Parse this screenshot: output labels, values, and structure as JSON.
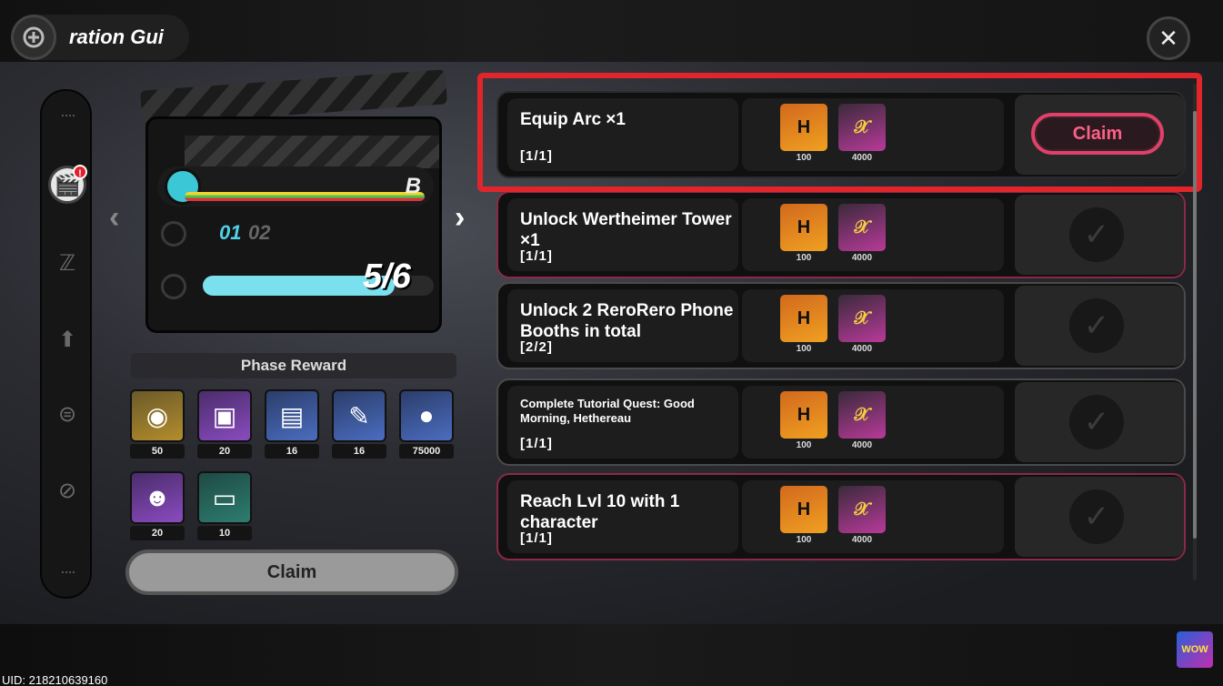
{
  "header": {
    "title": "ration Gui",
    "close_label": "✕"
  },
  "sidenav": {
    "badge": "!",
    "items": [
      {
        "icon": "clapperboard-icon"
      },
      {
        "icon": "z-logo-icon"
      },
      {
        "icon": "arrow-up-icon"
      },
      {
        "icon": "hamburger-icon"
      },
      {
        "icon": "no-eye-icon"
      }
    ]
  },
  "phase": {
    "rank": "B",
    "current": "01",
    "next": "02",
    "progress_text": "5/6",
    "progress_fraction": 0.83,
    "reward_title": "Phase Reward",
    "claim_label": "Claim"
  },
  "phase_rewards": [
    {
      "qty": "50",
      "icon": "polychrome-orb-icon",
      "color": "gold"
    },
    {
      "qty": "20",
      "icon": "tape-chip-icon",
      "color": "purple"
    },
    {
      "qty": "16",
      "icon": "data-card-icon",
      "color": "blue"
    },
    {
      "qty": "16",
      "icon": "paint-tube-icon",
      "color": "blue"
    },
    {
      "qty": "75000",
      "icon": "coin-icon",
      "color": "blue"
    },
    {
      "qty": "20",
      "icon": "bangboo-icon",
      "color": "purple"
    },
    {
      "qty": "10",
      "icon": "supply-case-icon",
      "color": "teal"
    }
  ],
  "quests": [
    {
      "title": "Equip Arc ×1",
      "progress": "[1/1]",
      "rewards": [
        "100",
        "4000"
      ],
      "status": "claim",
      "action_label": "Claim"
    },
    {
      "title": "Unlock Wertheimer Tower ×1",
      "progress": "[1/1]",
      "rewards": [
        "100",
        "4000"
      ],
      "status": "done"
    },
    {
      "title": "Unlock 2 ReroRero Phone Booths in total",
      "progress": "[2/2]",
      "rewards": [
        "100",
        "4000"
      ],
      "status": "done"
    },
    {
      "title": "Complete Tutorial Quest: Good Morning, Hethereau",
      "progress": "[1/1]",
      "rewards": [
        "100",
        "4000"
      ],
      "status": "done",
      "small": true
    },
    {
      "title": "Reach Lvl 10 with 1 character",
      "progress": "[1/1]",
      "rewards": [
        "100",
        "4000"
      ],
      "status": "done"
    }
  ],
  "footer": {
    "uid": "UID: 218210639160",
    "watermark": "WOW"
  }
}
